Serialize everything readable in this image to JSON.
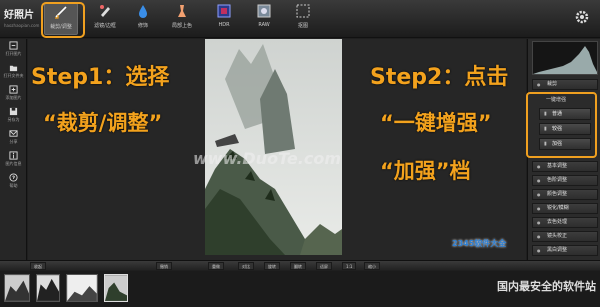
{
  "app": {
    "logo_main": "好照片",
    "logo_sub": "haozhaopian.com"
  },
  "toolbar": {
    "tools": [
      {
        "label": "裁剪/调整",
        "icon": "crop-adjust-icon"
      },
      {
        "label": "滤镜/边框",
        "icon": "filter-frame-icon"
      },
      {
        "label": "修饰",
        "icon": "retouch-drop-icon"
      },
      {
        "label": "局部上色",
        "icon": "local-color-icon"
      },
      {
        "label": "HDR",
        "icon": "hdr-icon"
      },
      {
        "label": "RAW",
        "icon": "raw-icon"
      },
      {
        "label": "抠图",
        "icon": "cutout-icon"
      }
    ]
  },
  "sidebar": {
    "items": [
      {
        "label": "打开图片",
        "icon": "open-image-icon"
      },
      {
        "label": "打开文件夹",
        "icon": "open-folder-icon"
      },
      {
        "label": "添加图片",
        "icon": "add-image-icon"
      },
      {
        "label": "另存为",
        "icon": "save-as-icon"
      },
      {
        "label": "分享",
        "icon": "share-icon"
      },
      {
        "label": "图片信息",
        "icon": "image-info-icon"
      },
      {
        "label": "帮助",
        "icon": "help-icon"
      }
    ]
  },
  "overlay": {
    "step1_line1": "Step1：选择",
    "step1_line2": "“裁剪/调整”",
    "step2_line1": "Step2：点击",
    "step2_line2": "“一键增强”",
    "step2_line3": "“加强”档",
    "watermark": "www.DuoTe.com"
  },
  "right_panel": {
    "top_label": "裁剪",
    "enhance_title": "一键增强",
    "enhance_buttons": [
      "普通",
      "较强",
      "加强"
    ],
    "sections": [
      "基本调整",
      "色阶调整",
      "颜色调整",
      "锐化/模糊",
      "去色处理",
      "镜头校正",
      "黑白调整"
    ]
  },
  "bottom_bar": {
    "items": [
      "收起",
      "撤销",
      "重做",
      "对比",
      "旋转",
      "翻转",
      "适屏",
      "1:1",
      "缩小"
    ]
  },
  "branding": {
    "site_logo": "2345软件大全",
    "site_mark": "国内最安全的软件站"
  },
  "colors": {
    "accent": "#f0a020",
    "step_text": "#f3a21d"
  }
}
